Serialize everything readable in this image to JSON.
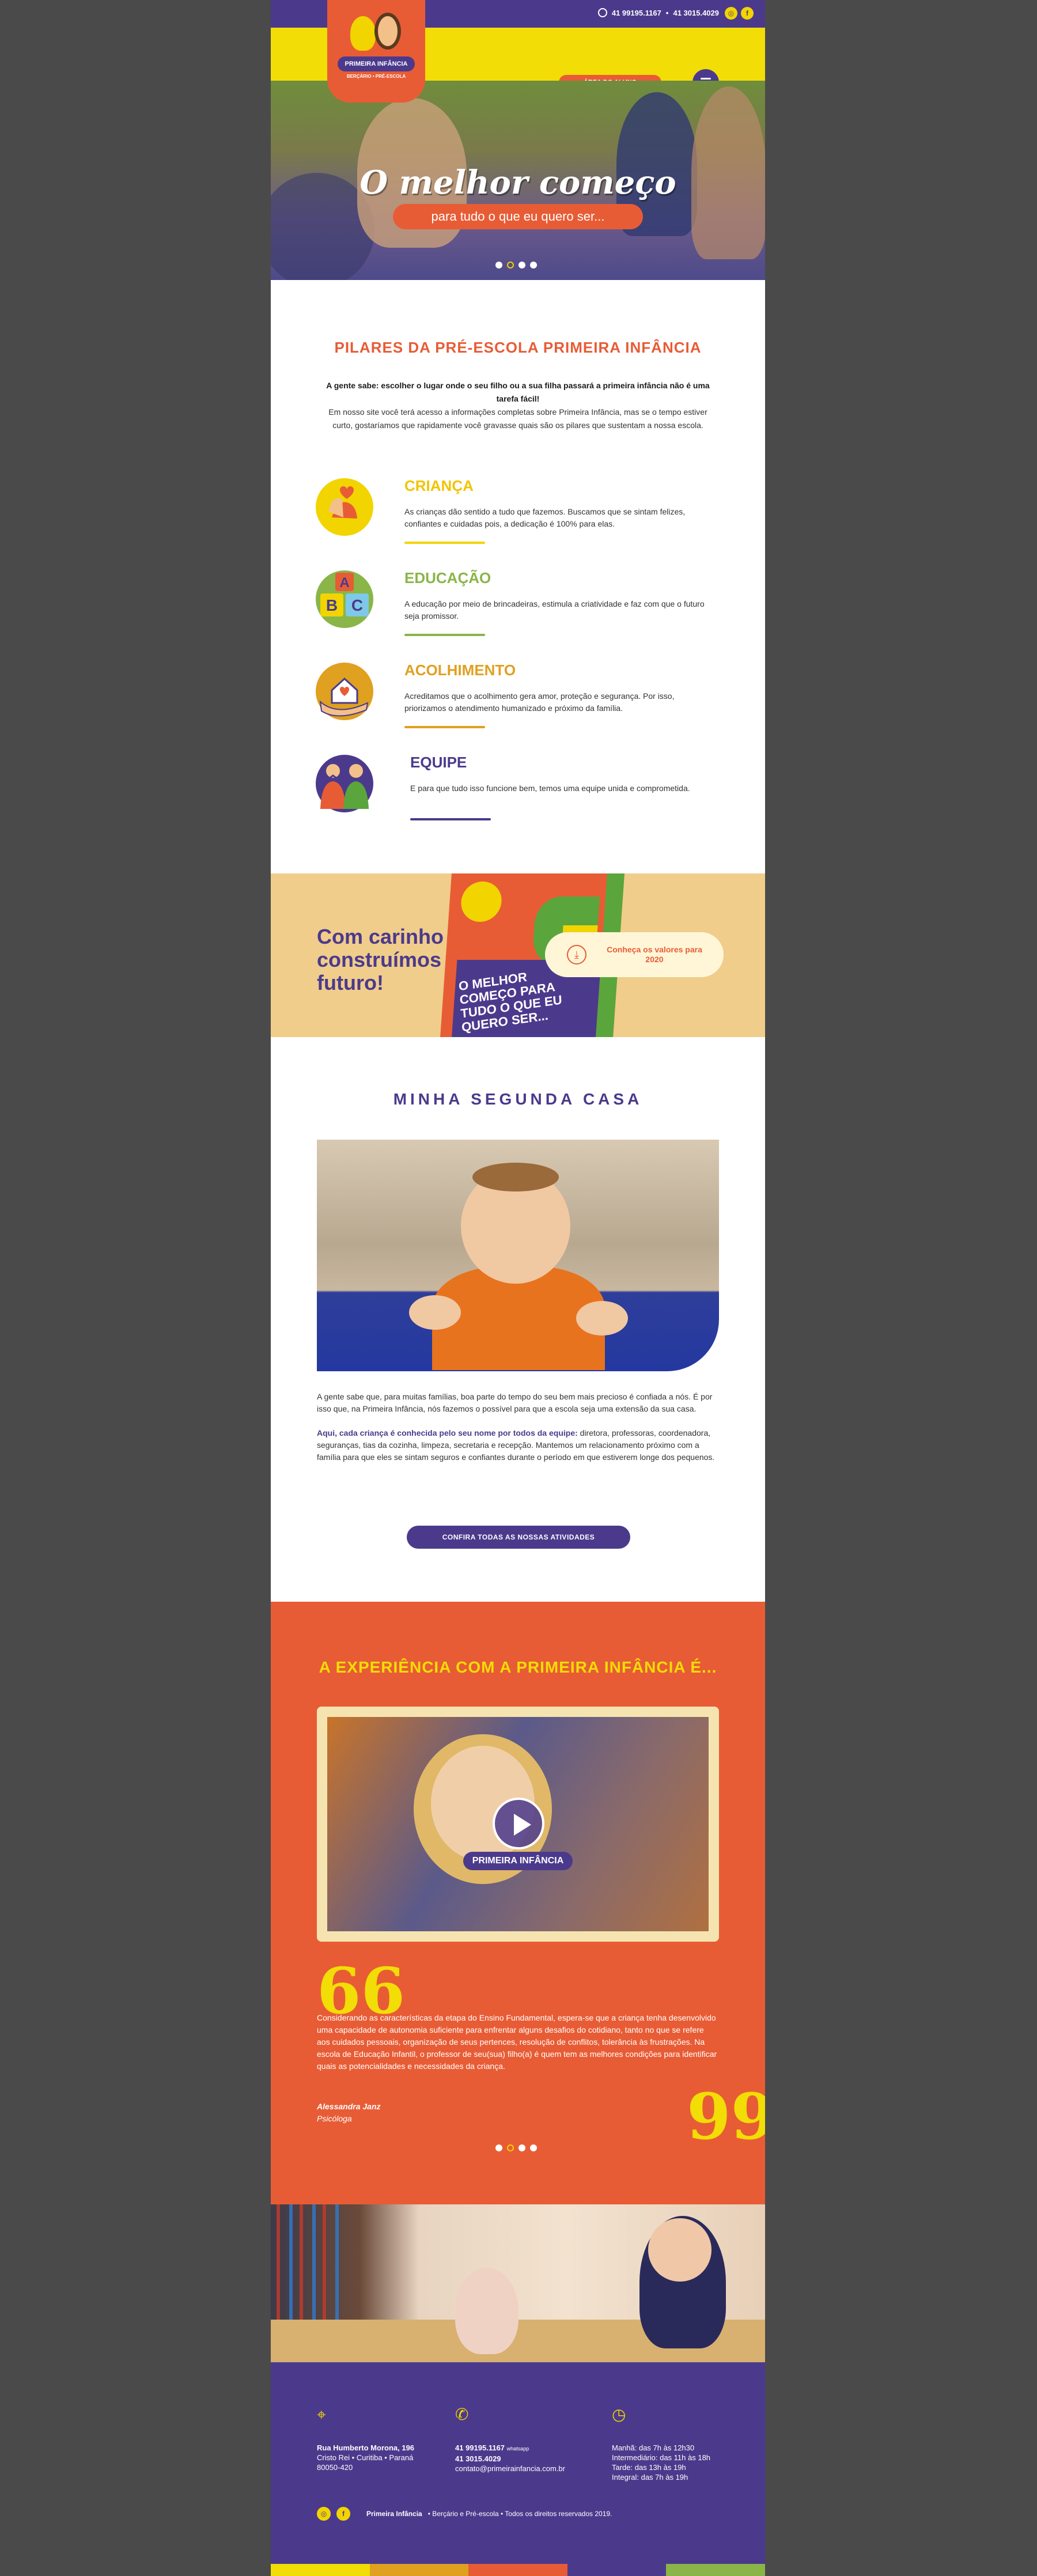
{
  "header": {
    "phone_whatsapp": "41 99195.1167",
    "phone_fixed": "41 3015.4029",
    "separator": "•",
    "social": [
      "instagram",
      "facebook"
    ],
    "logo_name": "PRIMEIRA INFÂNCIA",
    "logo_sub": "BERÇÁRIO • PRÉ-ESCOLA",
    "aluno_button": "ÁREA DO ALUNO",
    "menu_icon": "hamburger-icon"
  },
  "hero": {
    "headline": "O melhor começo",
    "tagline": "para tudo o que eu quero ser...",
    "slides": 4,
    "active_slide": 2
  },
  "pilares": {
    "title": "PILARES DA PRÉ-ESCOLA PRIMEIRA INFÂNCIA",
    "intro_bold": "A gente sabe: escolher o lugar onde o seu filho ou a sua filha passará a primeira infância não é uma tarefa fácil!",
    "intro_text": "Em nosso site você terá acesso a informações completas sobre Primeira Infância, mas se o tempo estiver curto, gostaríamos que rapidamente você gravasse quais são os pilares que sustentam a nossa escola.",
    "items": [
      {
        "title": "CRIANÇA",
        "text": "As crianças dão sentido a tudo que fazemos. Buscamos que se sintam felizes, confiantes e cuidadas pois, a dedicação é 100% para elas.",
        "color": "#f2c400",
        "icon": "hands-heart-icon"
      },
      {
        "title": "EDUCAÇÃO",
        "text": "A educação por meio de brincadeiras, estimula a criatividade e faz com que o futuro seja promissor.",
        "color": "#8ab548",
        "icon": "abc-blocks-icon"
      },
      {
        "title": "ACOLHIMENTO",
        "text": "Acreditamos que o acolhimento gera amor, proteção e segurança. Por isso, priorizamos o atendimento humanizado e próximo da família.",
        "color": "#e0a020",
        "icon": "house-hand-icon"
      },
      {
        "title": "EQUIPE",
        "text": "E para que tudo isso funcione bem, temos uma equipe unida e comprometida.",
        "color": "#4b3a8c",
        "icon": "team-icon"
      }
    ]
  },
  "banner": {
    "headline": "Com carinho construímos o futuro!",
    "book_text": "O MELHOR COMEÇO PARA TUDO O QUE EU QUERO SER...",
    "download_label": "Conheça os valores para 2020",
    "download_icon": "download-icon"
  },
  "casa": {
    "title": "MINHA SEGUNDA CASA",
    "para1": "A gente sabe que, para muitas famílias, boa parte do tempo do seu bem mais precioso é confiada a nós. É por isso que, na Primeira Infância, nós fazemos o possível para que a escola seja uma extensão da sua casa.",
    "para2_bold": "Aqui, cada criança é conhecida pelo seu nome por todos da equipe:",
    "para2_text": " diretora, professoras, coordenadora, seguranças, tias da cozinha, limpeza, secretaria e recepção. Mantemos um relacionamento próximo com a família para que eles se sintam seguros e confiantes durante o período em que estiverem longe dos pequenos.",
    "button": "CONFIRA TODAS AS NOSSAS ATIVIDADES"
  },
  "experiencia": {
    "title": "A EXPERIÊNCIA COM A PRIMEIRA INFÂNCIA É...",
    "video_label": "PRIMEIRA INFÂNCIA",
    "quote": "Considerando as características da etapa do Ensino Fundamental, espera-se que a criança tenha desenvolvido uma capacidade de autonomia suficiente para enfrentar alguns desafios do cotidiano, tanto no que se refere aos cuidados pessoais, organização de seus pertences, resolução de conflitos, tolerância às frustrações. Na escola de Educação Infantil, o professor de seu(sua) filho(a) é quem tem as melhores condições para identificar quais as potencialidades e necessidades da criança.",
    "author": "Alessandra Janz",
    "role": "Psicóloga",
    "open_quote": "66",
    "close_quote": "99",
    "slides": 4,
    "active_slide": 2
  },
  "footer": {
    "address_line1": "Rua Humberto Morona, 196",
    "address_line2": "Cristo Rei • Curitiba • Paraná",
    "address_line3": "80050-420",
    "phone1": "41 99195.1167",
    "phone1_note": "whatsapp",
    "phone2": "41 3015.4029",
    "email": "contato@primeirainfancia.com.br",
    "hours": [
      "Manhã: das 7h às 12h30",
      "Intermediário: das 11h às 18h",
      "Tarde: das 13h às 19h",
      "Integral: das 7h às 19h"
    ],
    "copyright_brand": "Primeira Infância",
    "copyright_text": "•  Berçário e Pré-escola  •  Todos os direitos reservados 2019.",
    "colors": [
      "#f2dd06",
      "#e0a020",
      "#e85c35",
      "#4b3a8c",
      "#8ab548"
    ]
  }
}
